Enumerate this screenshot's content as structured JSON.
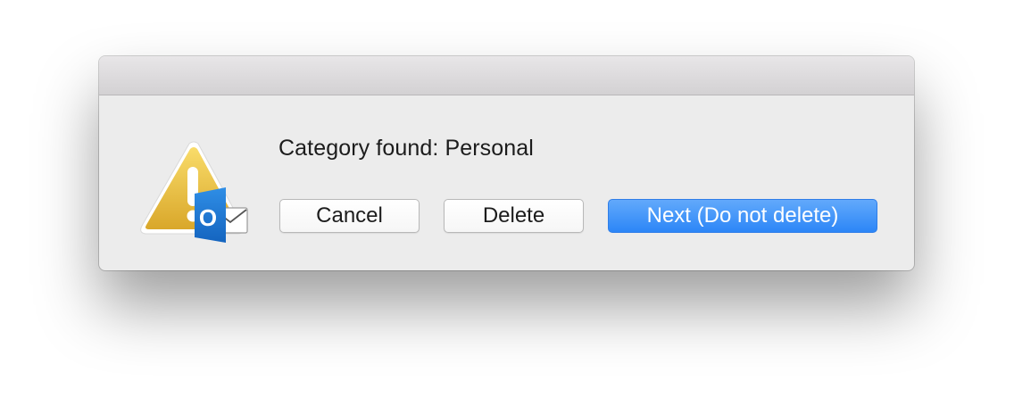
{
  "dialog": {
    "message": "Category found: Personal",
    "icon": "warning-triangle-with-outlook-icon",
    "badge_letter": "O",
    "buttons": {
      "cancel": "Cancel",
      "delete": "Delete",
      "next": "Next (Do not delete)"
    },
    "colors": {
      "default_button": "#2c86f7",
      "warning": "#f0c02e",
      "outlook_blue": "#1a72cc"
    }
  }
}
